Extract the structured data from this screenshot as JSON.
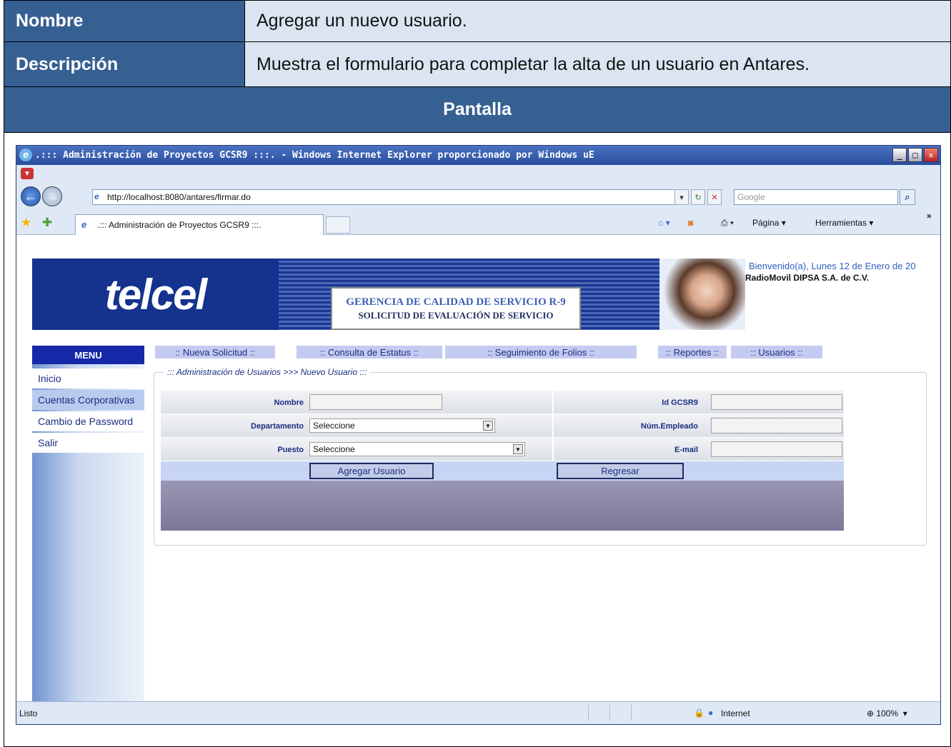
{
  "doc": {
    "nombre_label": "Nombre",
    "nombre_value": "Agregar un nuevo usuario.",
    "descripcion_label": "Descripción",
    "descripcion_value": "Muestra el formulario para completar la alta de un usuario en Antares.",
    "pantalla_label": "Pantalla"
  },
  "browser": {
    "title": ".::: Administración de Proyectos GCSR9 :::. - Windows Internet Explorer proporcionado por Windows uE",
    "address": "http://localhost:8080/antares/firmar.do",
    "search_placeholder": "Google",
    "tab_title": ".::: Administración de Proyectos GCSR9 :::.",
    "cmd_pagina": "Página",
    "cmd_herramientas": "Herramientas",
    "status_text": "Listo",
    "status_zone": "Internet",
    "zoom": "100%"
  },
  "page": {
    "logo": "telcel",
    "banner_line1": "GERENCIA DE CALIDAD DE SERVICIO R-9",
    "banner_line2": "SOLICITUD DE EVALUACIÓN DE SERVICIO",
    "welcome": "Bienvenido(a), Lunes 12 de Enero de 20",
    "company": "RadioMovil DIPSA S.A. de C.V.",
    "menu_title": "MENU",
    "menu_items": [
      "Inicio",
      "Cuentas Corporativas",
      "Cambio de Password",
      "Salir"
    ],
    "top_menu": [
      ":: Nueva Solicitud ::",
      ":: Consulta de Estatus ::",
      ":: Seguimiento de Folios ::",
      ":: Reportes ::",
      ":: Usuarios ::"
    ],
    "legend": "::: Administración de Usuarios >>> Nuevo Usuario :::",
    "form": {
      "nombre_label": "Nombre",
      "departamento_label": "Departamento",
      "departamento_value": "Seleccione",
      "puesto_label": "Puesto",
      "puesto_value": "Seleccione",
      "id_label": "Id GCSR9",
      "empleado_label": "Núm.Empleado",
      "email_label": "E-mail",
      "agregar_button": "Agregar Usuario",
      "regresar_button": "Regresar"
    }
  },
  "colors": {
    "header_blue": "#366092",
    "value_bg": "#dbe5f1",
    "menu_blue": "#1529a8"
  }
}
